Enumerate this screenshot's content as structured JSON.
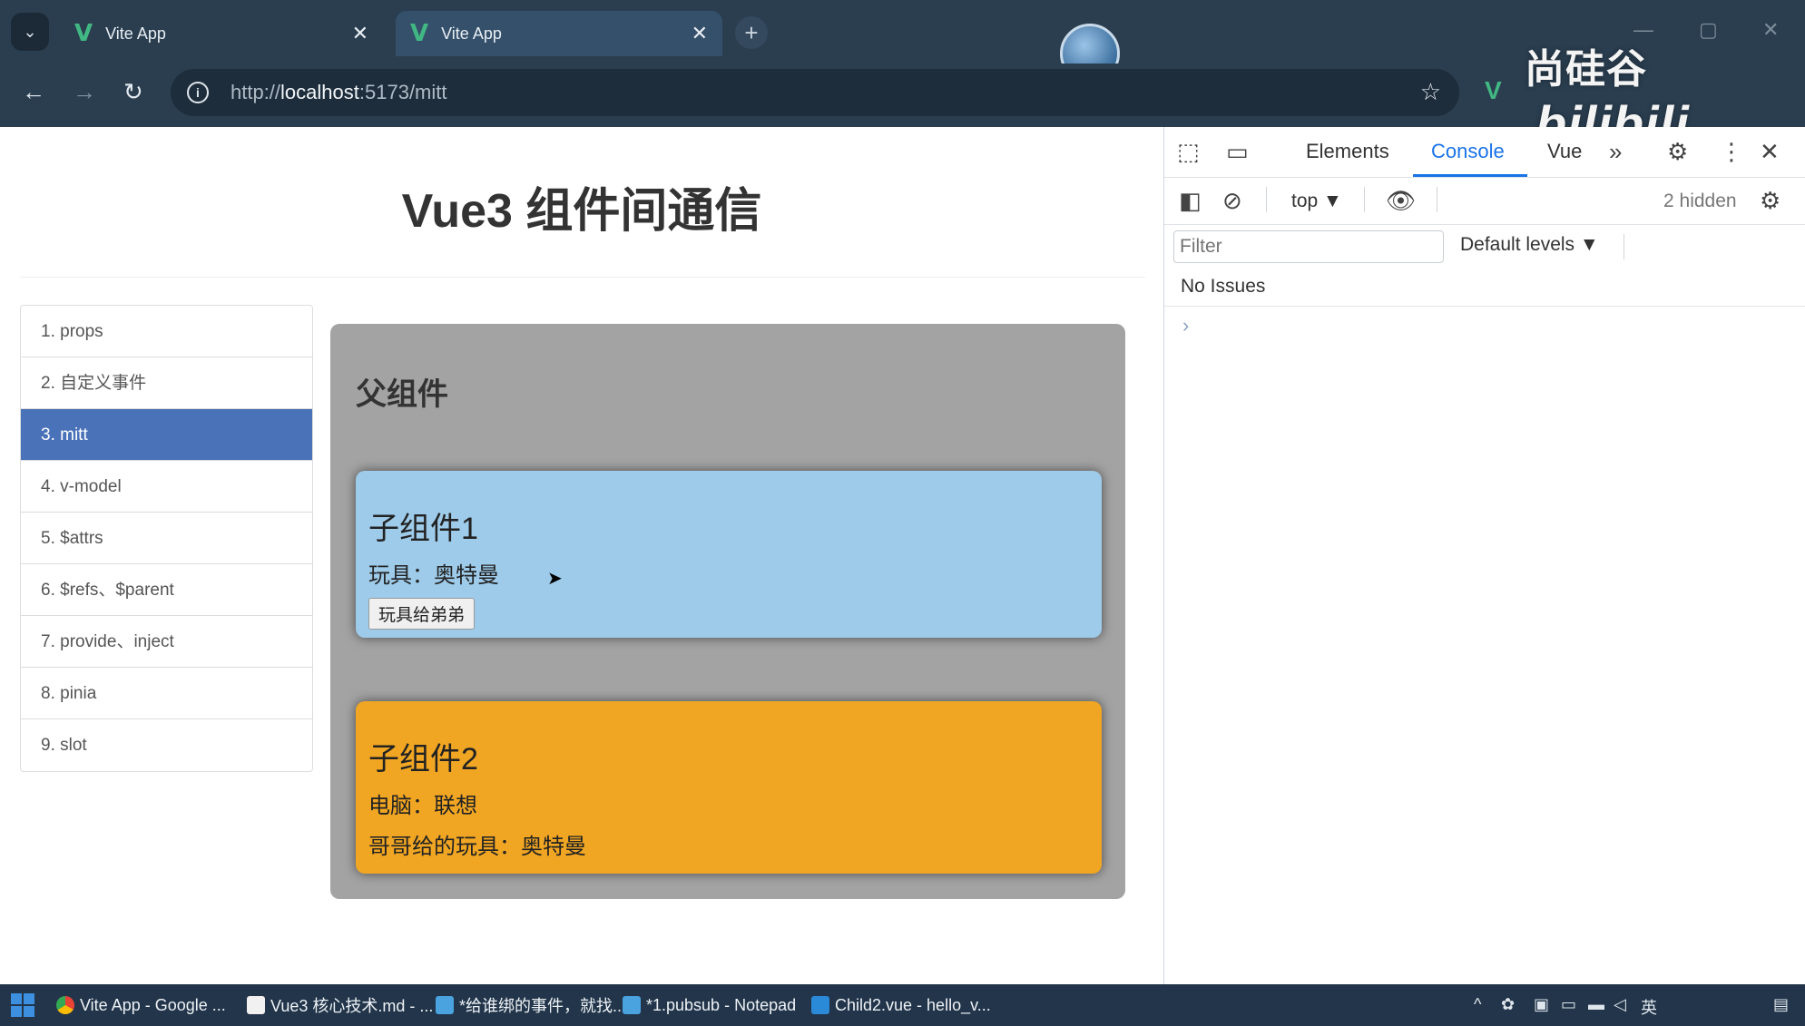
{
  "browser": {
    "tabs": [
      {
        "title": "Vite App",
        "active": false
      },
      {
        "title": "Vite App",
        "active": true
      }
    ],
    "url_prefix": "http://",
    "url_host": "localhost",
    "url_rest": ":5173/mitt"
  },
  "watermark": {
    "brand": "尚硅谷",
    "site": "bilibili"
  },
  "page": {
    "title": "Vue3 组件间通信",
    "nav": [
      {
        "label": "1. props",
        "active": false
      },
      {
        "label": "2. 自定义事件",
        "active": false
      },
      {
        "label": "3. mitt",
        "active": true
      },
      {
        "label": "4. v-model",
        "active": false
      },
      {
        "label": "5. $attrs",
        "active": false
      },
      {
        "label": "6. $refs、$parent",
        "active": false
      },
      {
        "label": "7. provide、inject",
        "active": false
      },
      {
        "label": "8. pinia",
        "active": false
      },
      {
        "label": "9. slot",
        "active": false
      }
    ],
    "father": {
      "title": "父组件",
      "child1": {
        "title": "子组件1",
        "toy": "玩具：奥特曼",
        "button": "玩具给弟弟"
      },
      "child2": {
        "title": "子组件2",
        "computer": "电脑：联想",
        "gift": "哥哥给的玩具：奥特曼"
      }
    },
    "colors": {
      "nav_active": "#4a72b8",
      "father_bg": "#a3a3a3",
      "child1_bg": "#9ecbea",
      "child2_bg": "#f0a623"
    }
  },
  "devtools": {
    "tabs": [
      "Elements",
      "Console",
      "Vue"
    ],
    "active_tab": "Console",
    "context": "top",
    "hidden_count": "2 hidden",
    "filter_placeholder": "Filter",
    "levels": "Default levels",
    "issues": "No Issues"
  },
  "taskbar": {
    "items": [
      "Vite App - Google ...",
      "Vue3 核心技术.md - ...",
      "*给谁绑的事件，就找...",
      "*1.pubsub - Notepad",
      "Child2.vue - hello_v..."
    ],
    "lang": "英"
  }
}
